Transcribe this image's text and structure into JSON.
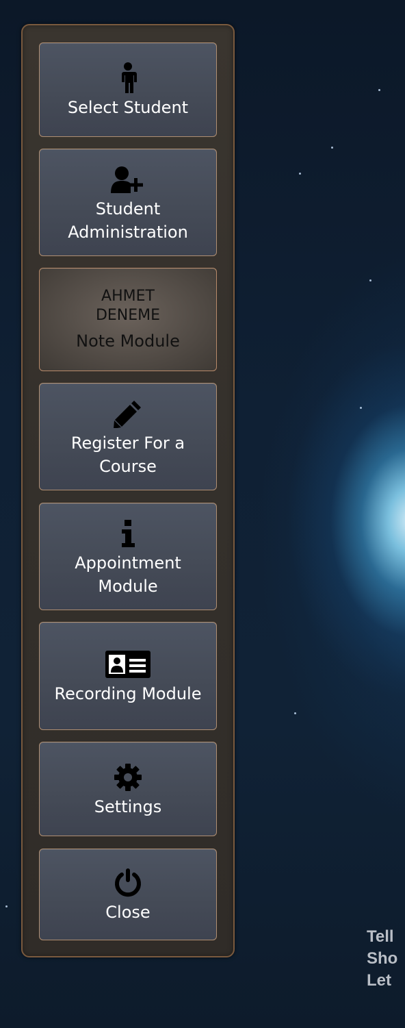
{
  "menu": {
    "items": [
      {
        "label": "Select Student",
        "icon": "person-icon"
      },
      {
        "label": "Student Administration",
        "icon": "add-user-icon"
      },
      {
        "label": "Note Module",
        "student_first": "AHMET",
        "student_last": "DENEME",
        "active": true
      },
      {
        "label": "Register For a Course",
        "icon": "pencil-icon"
      },
      {
        "label": "Appointment Module",
        "icon": "info-icon"
      },
      {
        "label": "Recording Module",
        "icon": "id-card-icon"
      },
      {
        "label": "Settings",
        "icon": "gear-icon"
      },
      {
        "label": "Close",
        "icon": "power-icon"
      }
    ]
  },
  "background_text": {
    "line1": "Tell",
    "line2": "Sho",
    "line3": "Let"
  },
  "colors": {
    "button_border": "#b08f72",
    "panel_border": "#7a5a3e",
    "button_bg": "#474d59",
    "active_bg": "#57504a",
    "text": "#ffffff"
  }
}
